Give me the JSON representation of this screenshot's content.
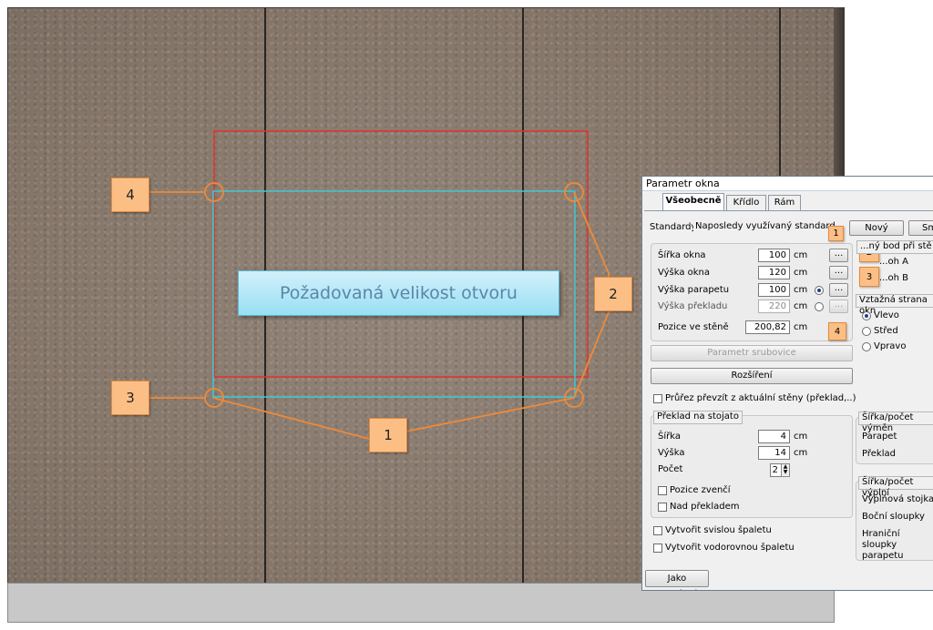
{
  "viewport": {
    "label": "Požadovaná velikost otvoru",
    "callouts": [
      "1",
      "2",
      "3",
      "4"
    ]
  },
  "dialog": {
    "title": "Parametr okna",
    "tabs": [
      "Všeobecně",
      "Křídlo",
      "Rám"
    ],
    "standards_label": "Standardy:",
    "standards_value": "Naposledy využívaný standard",
    "btn_new": "Nový",
    "btn_sm": "Sm",
    "fields": [
      {
        "label": "Šířka okna",
        "value": "100",
        "unit": "cm"
      },
      {
        "label": "Výška okna",
        "value": "120",
        "unit": "cm"
      },
      {
        "label": "Výška parapetu",
        "value": "100",
        "unit": "cm"
      },
      {
        "label": "Výška překladu",
        "value": "220",
        "unit": "cm"
      }
    ],
    "position_label": "Pozice ve stěně",
    "position_value": "200,82",
    "position_unit": "cm",
    "dots": "...",
    "ref_point_head": "...ný bod při stě",
    "ref_a": "...oh A",
    "ref_b": "...oh B",
    "side_head": "Vztažná strana okn",
    "side_options": [
      "Vlevo",
      "Střed",
      "Vpravo"
    ],
    "btn_params": "Parametr srubovice",
    "btn_expand": "Rozšíření",
    "chk_profile": "Průřez převzít z aktuální stěny (překlad,..)",
    "lintel_head": "Překlad na stojato",
    "lintel_fields": [
      {
        "label": "Šířka",
        "value": "4",
        "unit": "cm"
      },
      {
        "label": "Výška",
        "value": "14",
        "unit": "cm"
      },
      {
        "label": "Počet",
        "value": "2"
      }
    ],
    "chk_outer": "Pozice zvenčí",
    "chk_above": "Nad překladem",
    "chk_vertical": "Vytvořit svislou špaletu",
    "chk_horizontal": "Vytvořit vodorovnou špaletu",
    "btn_as_standard": "Jako standard",
    "cut_head": "Šířka/počet výměn",
    "cut_items": [
      "Parapet",
      "Překlad"
    ],
    "fill_head": "Šířka/počet výplní",
    "fill_items": [
      "Výplňová stojka",
      "Boční sloupky",
      "Hraniční sloupky parapetu"
    ],
    "mini_callouts": [
      "1",
      "2",
      "3",
      "4"
    ]
  }
}
